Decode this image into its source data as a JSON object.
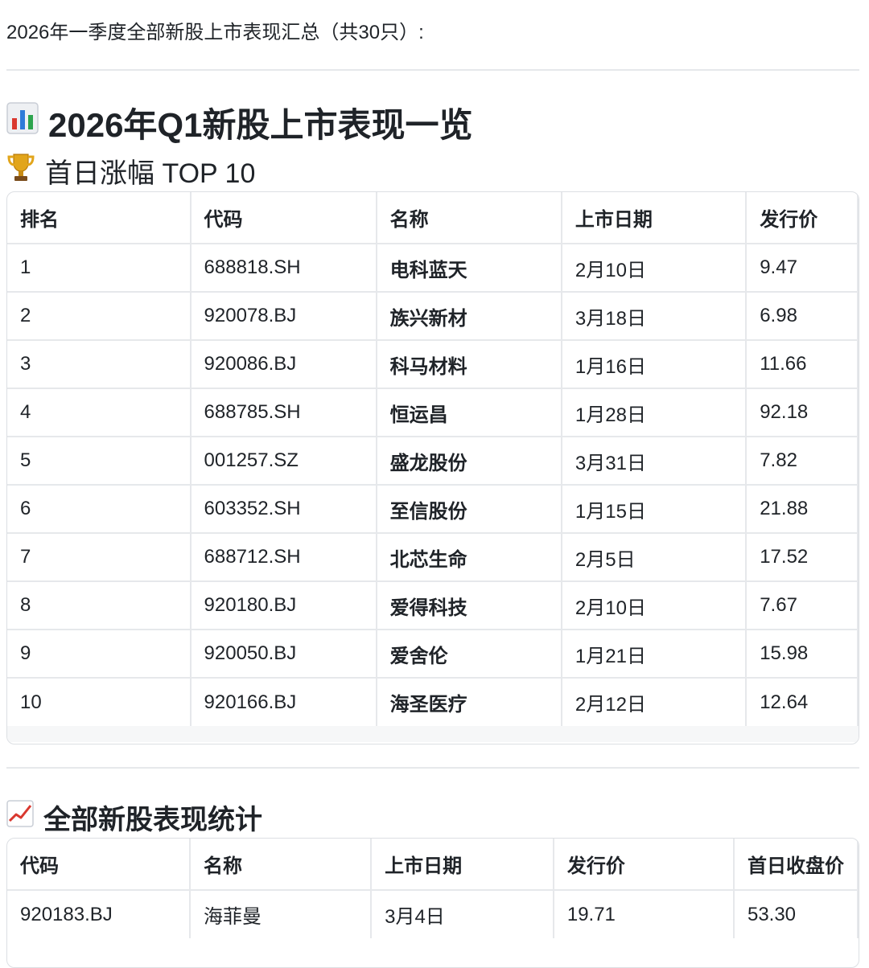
{
  "intro": "2026年一季度全部新股上市表现汇总（共30只）:",
  "main_title": "2026年Q1新股上市表现一览",
  "section1": {
    "title": "首日涨幅 TOP 10",
    "headers": [
      "排名",
      "代码",
      "名称",
      "上市日期",
      "发行价"
    ],
    "rows": [
      [
        "1",
        "688818.SH",
        "电科蓝天",
        "2月10日",
        "9.47"
      ],
      [
        "2",
        "920078.BJ",
        "族兴新材",
        "3月18日",
        "6.98"
      ],
      [
        "3",
        "920086.BJ",
        "科马材料",
        "1月16日",
        "11.66"
      ],
      [
        "4",
        "688785.SH",
        "恒运昌",
        "1月28日",
        "92.18"
      ],
      [
        "5",
        "001257.SZ",
        "盛龙股份",
        "3月31日",
        "7.82"
      ],
      [
        "6",
        "603352.SH",
        "至信股份",
        "1月15日",
        "21.88"
      ],
      [
        "7",
        "688712.SH",
        "北芯生命",
        "2月5日",
        "17.52"
      ],
      [
        "8",
        "920180.BJ",
        "爱得科技",
        "2月10日",
        "7.67"
      ],
      [
        "9",
        "920050.BJ",
        "爱舍伦",
        "1月21日",
        "15.98"
      ],
      [
        "10",
        "920166.BJ",
        "海圣医疗",
        "2月12日",
        "12.64"
      ]
    ]
  },
  "section2": {
    "title": "全部新股表现统计",
    "headers": [
      "代码",
      "名称",
      "上市日期",
      "发行价",
      "首日收盘价"
    ],
    "rows": [
      [
        "920183.BJ",
        "海菲曼",
        "3月4日",
        "19.71",
        "53.30"
      ]
    ]
  }
}
